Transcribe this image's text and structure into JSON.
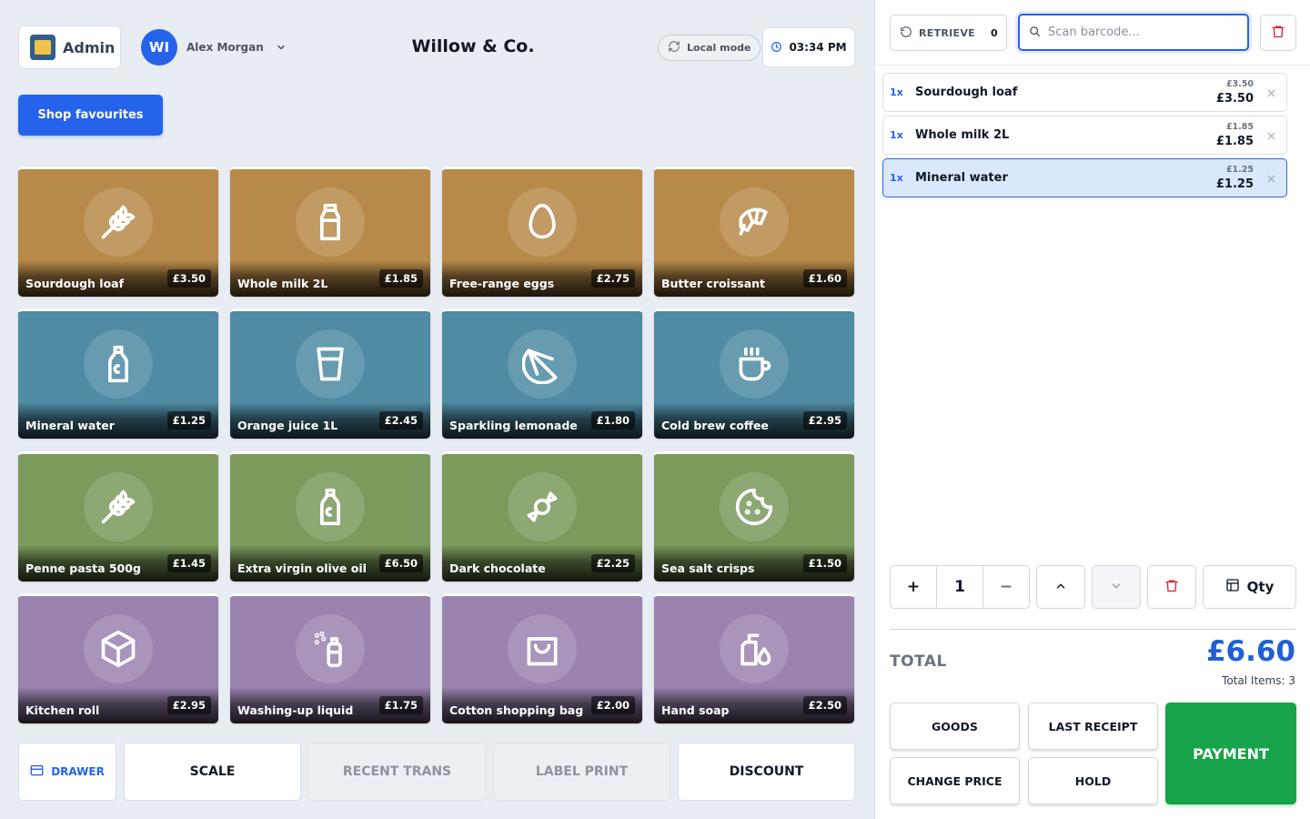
{
  "header": {
    "admin_label": "Admin",
    "user_initials": "WI",
    "user_name": "Alex Morgan",
    "store_name": "Willow & Co.",
    "mode_label": "Local mode",
    "time": "03:34 PM"
  },
  "favourites_button": "Shop favourites",
  "products": [
    {
      "name": "Sourdough loaf",
      "price": "£3.50",
      "icon": "wheat-icon",
      "color": "#b88a4a"
    },
    {
      "name": "Whole milk 2L",
      "price": "£1.85",
      "icon": "milk-bottle-icon",
      "color": "#b88a4a"
    },
    {
      "name": "Free-range eggs",
      "price": "£2.75",
      "icon": "egg-icon",
      "color": "#b88a4a"
    },
    {
      "name": "Butter croissant",
      "price": "£1.60",
      "icon": "croissant-icon",
      "color": "#b88a4a"
    },
    {
      "name": "Mineral water",
      "price": "£1.25",
      "icon": "water-bottle-icon",
      "color": "#4f8ba3"
    },
    {
      "name": "Orange juice 1L",
      "price": "£2.45",
      "icon": "glass-icon",
      "color": "#4f8ba3"
    },
    {
      "name": "Sparkling lemonade",
      "price": "£1.80",
      "icon": "citrus-icon",
      "color": "#4f8ba3"
    },
    {
      "name": "Cold brew coffee",
      "price": "£2.95",
      "icon": "coffee-icon",
      "color": "#4f8ba3"
    },
    {
      "name": "Penne pasta 500g",
      "price": "£1.45",
      "icon": "wheat-icon",
      "color": "#7b9a5c"
    },
    {
      "name": "Extra virgin olive oil",
      "price": "£6.50",
      "icon": "oil-bottle-icon",
      "color": "#7b9a5c"
    },
    {
      "name": "Dark chocolate",
      "price": "£2.25",
      "icon": "candy-icon",
      "color": "#7b9a5c"
    },
    {
      "name": "Sea salt crisps",
      "price": "£1.50",
      "icon": "cookie-icon",
      "color": "#7b9a5c"
    },
    {
      "name": "Kitchen roll",
      "price": "£2.95",
      "icon": "box-icon",
      "color": "#9b83b0"
    },
    {
      "name": "Washing-up liquid",
      "price": "£1.75",
      "icon": "spray-bottle-icon",
      "color": "#9b83b0"
    },
    {
      "name": "Cotton shopping bag",
      "price": "£2.00",
      "icon": "shopping-bag-icon",
      "color": "#9b83b0"
    },
    {
      "name": "Hand soap",
      "price": "£2.50",
      "icon": "soap-icon",
      "color": "#9b83b0"
    }
  ],
  "bottom_buttons": {
    "drawer": "DRAWER",
    "scale": "SCALE",
    "recent_trans": "RECENT TRANS",
    "label_print": "LABEL PRINT",
    "discount": "DISCOUNT"
  },
  "retrieve": {
    "label": "RETRIEVE",
    "count": "0"
  },
  "search": {
    "placeholder": "Scan barcode..."
  },
  "cart": [
    {
      "qty": "1x",
      "name": "Sourdough loaf",
      "unit_price": "£3.50",
      "total": "£3.50",
      "selected": false
    },
    {
      "qty": "1x",
      "name": "Whole milk 2L",
      "unit_price": "£1.85",
      "total": "£1.85",
      "selected": false
    },
    {
      "qty": "1x",
      "name": "Mineral water",
      "unit_price": "£1.25",
      "total": "£1.25",
      "selected": true
    }
  ],
  "stepper": {
    "plus": "+",
    "value": "1",
    "minus": "−"
  },
  "qty_button": "Qty",
  "totals": {
    "label": "TOTAL",
    "amount": "£6.60",
    "items_label": "Total Items: 3"
  },
  "actions": {
    "goods": "GOODS",
    "last_receipt": "LAST RECEIPT",
    "change_price": "CHANGE PRICE",
    "hold": "HOLD",
    "payment": "PAYMENT"
  },
  "colors": {
    "accent": "#2563eb",
    "payment": "#16a34a",
    "danger": "#dc2626"
  }
}
